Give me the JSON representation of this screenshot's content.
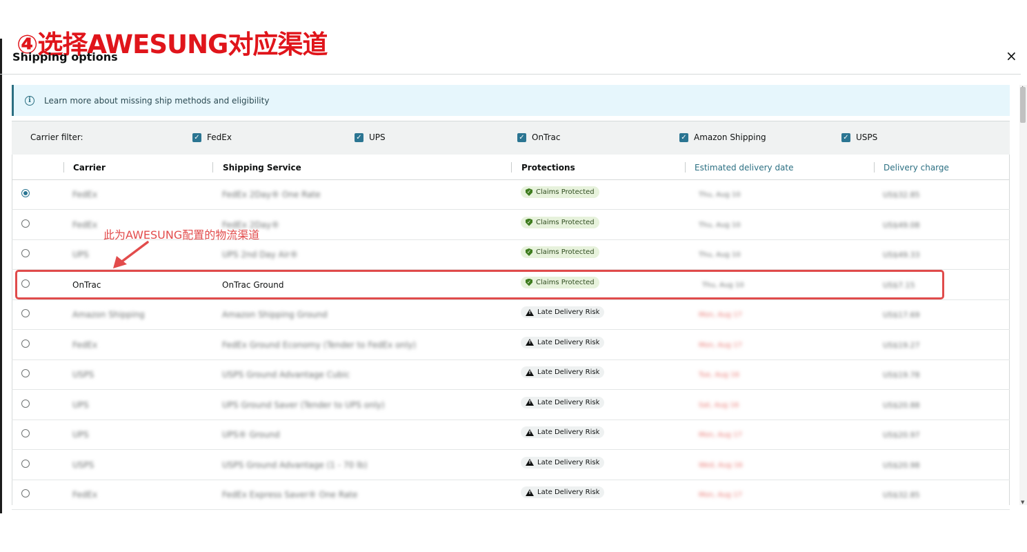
{
  "annotation": {
    "title": "④选择AWESUNG对应渠道",
    "note": "此为AWESUNG配置的物流渠道"
  },
  "modal": {
    "title": "Shipping options",
    "close": "×"
  },
  "info": {
    "text": "Learn more about missing ship methods and eligibility",
    "icon": "info-icon"
  },
  "filter": {
    "label": "Carrier filter:",
    "carriers": [
      "FedEx",
      "UPS",
      "OnTrac",
      "Amazon Shipping",
      "USPS"
    ]
  },
  "table": {
    "headers": [
      "Carrier",
      "Shipping Service",
      "Protections",
      "Estimated delivery date",
      "Delivery charge"
    ],
    "rows": [
      {
        "carrier": "FedEx",
        "service": "FedEx 2Day® One Rate",
        "protection": "Claims Protected",
        "date": "Thu, Aug 10",
        "charge": "US$32.85",
        "selected": true
      },
      {
        "carrier": "FedEx",
        "service": "FedEx 2Day®",
        "protection": "Claims Protected",
        "date": "Thu, Aug 10",
        "charge": "US$49.08",
        "selected": false
      },
      {
        "carrier": "UPS",
        "service": "UPS 2nd Day Air®",
        "protection": "Claims Protected",
        "date": "Thu, Aug 10",
        "charge": "US$49.33",
        "selected": false
      },
      {
        "carrier": "OnTrac",
        "service": "OnTrac Ground",
        "protection": "Claims Protected",
        "date": "Thu, Aug 10",
        "charge": "US$7.15",
        "selected": false
      },
      {
        "carrier": "Amazon Shipping",
        "service": "Amazon Shipping Ground",
        "protection": "Late Delivery Risk",
        "date": "Mon, Aug 17",
        "charge": "US$17.69",
        "selected": false
      },
      {
        "carrier": "FedEx",
        "service": "FedEx Ground Economy (Tender to FedEx only)",
        "protection": "Late Delivery Risk",
        "date": "Mon, Aug 17",
        "charge": "US$19.27",
        "selected": false
      },
      {
        "carrier": "USPS",
        "service": "USPS Ground Advantage Cubic",
        "protection": "Late Delivery Risk",
        "date": "Tue, Aug 16",
        "charge": "US$19.78",
        "selected": false
      },
      {
        "carrier": "UPS",
        "service": "UPS Ground Saver (Tender to UPS only)",
        "protection": "Late Delivery Risk",
        "date": "Sat, Aug 16",
        "charge": "US$20.88",
        "selected": false
      },
      {
        "carrier": "UPS",
        "service": "UPS® Ground",
        "protection": "Late Delivery Risk",
        "date": "Mon, Aug 17",
        "charge": "US$20.97",
        "selected": false
      },
      {
        "carrier": "USPS",
        "service": "USPS Ground Advantage (1 - 70 lb)",
        "protection": "Late Delivery Risk",
        "date": "Wed, Aug 16",
        "charge": "US$20.98",
        "selected": false
      },
      {
        "carrier": "FedEx",
        "service": "FedEx Express Saver® One Rate",
        "protection": "Late Delivery Risk",
        "date": "Mon, Aug 17",
        "charge": "US$32.85",
        "selected": false
      }
    ]
  },
  "colors": {
    "accent": "#2b7592",
    "annotation_red": "#e0151b",
    "protected_bg": "#e7f2dc"
  }
}
